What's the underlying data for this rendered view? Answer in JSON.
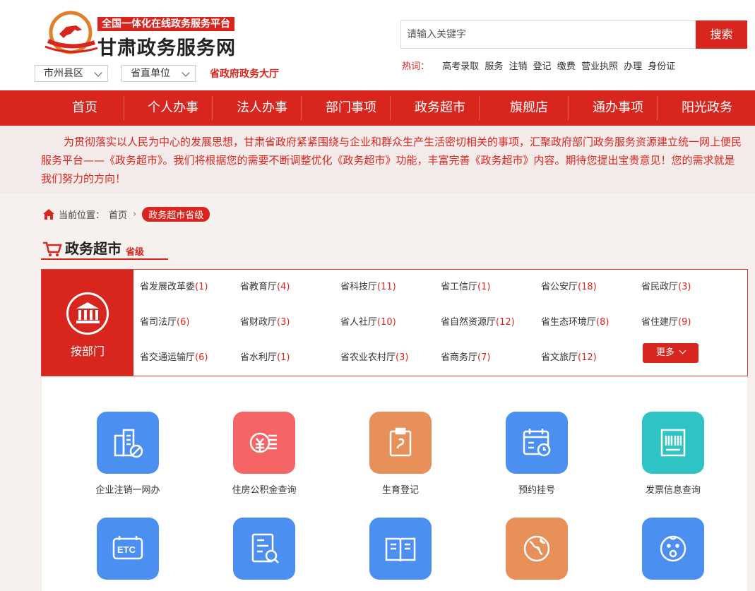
{
  "header": {
    "slogan": "全国一体化在线政务服务平台",
    "site_title": "甘肃政务服务网",
    "select_city": "市州县区",
    "select_prov": "省直单位",
    "hall_link": "省政府政务大厅",
    "search_placeholder": "请输入关键字",
    "search_button": "搜索",
    "hot_label": "热词：",
    "hot_words": [
      "高考录取",
      "服务",
      "注销",
      "登记",
      "缴费",
      "营业执照",
      "办理",
      "身份证"
    ]
  },
  "nav": [
    "首页",
    "个人办事",
    "法人办事",
    "部门事项",
    "政务超市",
    "旗舰店",
    "通办事项",
    "阳光政务"
  ],
  "intro": "为贯彻落实以人民为中心的发展思想，甘肃省政府紧紧围绕与企业和群众生产生活密切相关的事项，汇聚政府部门政务服务资源建立统一网上便民服务平台——《政务超市》。我们将根据您的需要不断调整优化《政务超市》功能，丰富完善《政务超市》内容。期待您提出宝贵意见！您的需求就是我们努力的方向！",
  "breadcrumb": {
    "label": "当前位置：",
    "home": "首页",
    "current": "政务超市省级"
  },
  "section": {
    "title": "政务超市",
    "sub": "省级"
  },
  "dept_panel": {
    "side_label": "按部门",
    "more": "更多",
    "depts": [
      {
        "name": "省发展改革委",
        "count": "(1)"
      },
      {
        "name": "省教育厅",
        "count": "(4)"
      },
      {
        "name": "省科技厅",
        "count": "(11)"
      },
      {
        "name": "省工信厅",
        "count": "(1)"
      },
      {
        "name": "省公安厅",
        "count": "(18)"
      },
      {
        "name": "省民政厅",
        "count": "(3)"
      },
      {
        "name": "省司法厅",
        "count": "(6)"
      },
      {
        "name": "省财政厅",
        "count": "(3)"
      },
      {
        "name": "省人社厅",
        "count": "(10)"
      },
      {
        "name": "省自然资源厅",
        "count": "(12)"
      },
      {
        "name": "省生态环境厅",
        "count": "(8)"
      },
      {
        "name": "省住建厅",
        "count": "(9)"
      },
      {
        "name": "省交通运输厅",
        "count": "(6)"
      },
      {
        "name": "省水利厅",
        "count": "(1)"
      },
      {
        "name": "省农业农村厅",
        "count": "(3)"
      },
      {
        "name": "省商务厅",
        "count": "(7)"
      },
      {
        "name": "省文旅厅",
        "count": "(12)"
      }
    ]
  },
  "services": [
    {
      "name": "企业注销一网办",
      "icon": "building-cancel-icon",
      "color": "#4b8ff0"
    },
    {
      "name": "住房公积金查询",
      "icon": "coins-icon",
      "color": "#f56565"
    },
    {
      "name": "生育登记",
      "icon": "clipboard-icon",
      "color": "#e8905a"
    },
    {
      "name": "预约挂号",
      "icon": "calendar-clock-icon",
      "color": "#4b8ff0"
    },
    {
      "name": "发票信息查询",
      "icon": "barcode-icon",
      "color": "#2ec4c6"
    },
    {
      "name": "",
      "icon": "etc-icon",
      "color": "#4b8ff0"
    },
    {
      "name": "",
      "icon": "credit-search-icon",
      "color": "#4b8ff0"
    },
    {
      "name": "",
      "icon": "book-icon",
      "color": "#4b8ff0"
    },
    {
      "name": "",
      "icon": "globe-icon",
      "color": "#e8905a"
    },
    {
      "name": "",
      "icon": "baby-icon",
      "color": "#4b8ff0"
    }
  ]
}
